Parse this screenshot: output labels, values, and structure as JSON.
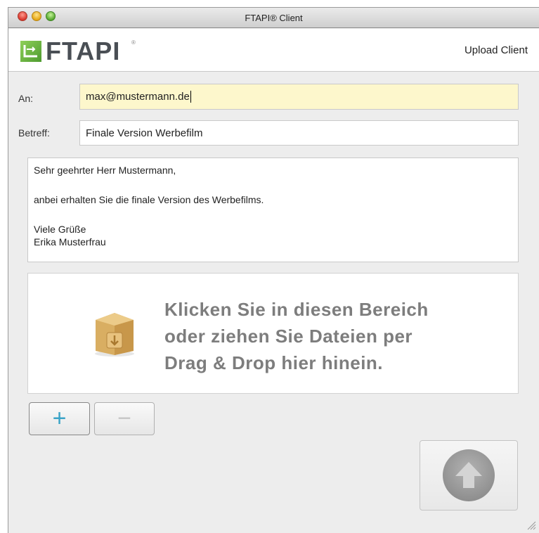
{
  "window": {
    "title": "FTAPI® Client"
  },
  "header": {
    "logo_text": "FTAPI",
    "logo_reg": "®",
    "mode_label": "Upload Client"
  },
  "form": {
    "to_label": "An:",
    "to_value": "max@mustermann.de",
    "subject_label": "Betreff:",
    "subject_value": "Finale Version Werbefilm",
    "body_lines": [
      "Sehr geehrter Herr Mustermann,",
      "anbei erhalten Sie die finale Version des Werbefilms.",
      "Viele Grüße",
      "Erika Musterfrau"
    ]
  },
  "dropzone": {
    "lines": [
      "Klicken Sie in diesen Bereich",
      "oder ziehen Sie Dateien per",
      "Drag & Drop hier hinein."
    ],
    "icon": "package-box-icon"
  },
  "buttons": {
    "add_label": "+",
    "remove_label": "−",
    "send_icon": "upload-arrow-icon"
  },
  "colors": {
    "to_field_bg": "#fdf7cc",
    "add_button": "#3aa3c7",
    "logo_green": "#6dba45"
  }
}
